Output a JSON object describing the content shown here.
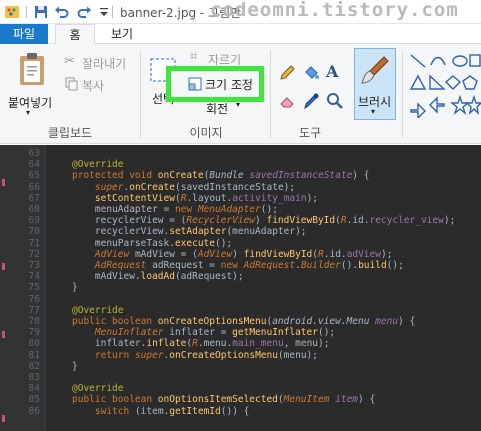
{
  "titlebar": {
    "title": "banner-2.jpg - 그림판",
    "watermark": "codeomni.tistory.com"
  },
  "tabs": [
    {
      "label": "파일"
    },
    {
      "label": "홈"
    },
    {
      "label": "보기"
    }
  ],
  "ribbon": {
    "clipboard": {
      "paste": "붙여넣기",
      "cut": "잘라내기",
      "copy": "복사",
      "group": "클립보드"
    },
    "image": {
      "select": "선택",
      "crop": "자르기",
      "resize": "크기 조정",
      "rotate": "회전",
      "group": "이미지"
    },
    "tools": {
      "group": "도구"
    },
    "brush": {
      "label": "브러시"
    }
  },
  "editor": {
    "lines": [
      {
        "n": "63",
        "html": ""
      },
      {
        "n": "64",
        "html": "<span class='ann'>@Override</span>"
      },
      {
        "n": "65",
        "html": "<span class='kw'>protected void </span><span class='call'>onCreate</span>(<span class='ital'>Bundle </span><span class='fld ital'>savedInstanceState</span>) {"
      },
      {
        "n": "66",
        "html": "    <span class='kw ital'>super</span>.<span class='call'>onCreate</span>(savedInstanceState);"
      },
      {
        "n": "67",
        "html": "    <span class='call'>setContentView</span>(<span class='typ'>R</span>.layout.<span class='fld'>activity_main</span>);"
      },
      {
        "n": "68",
        "html": "    menuAdapter = <span class='kw'>new </span><span class='typ'>MenuAdapter</span>();"
      },
      {
        "n": "69",
        "html": "    recyclerView = (<span class='typ'>RecyclerView</span>) <span class='call'>findViewById</span>(<span class='typ'>R</span>.id.<span class='fld'>recycler_view</span>);"
      },
      {
        "n": "70",
        "html": "    recyclerView.<span class='call'>setAdapter</span>(menuAdapter);"
      },
      {
        "n": "71",
        "html": "    menuParseTask.<span class='call'>execute</span>();"
      },
      {
        "n": "72",
        "html": "    <span class='typ'>AdView </span>mAdView = (<span class='typ'>AdView</span>) <span class='call'>findViewById</span>(<span class='typ'>R</span>.id.<span class='fld'>adView</span>);"
      },
      {
        "n": "73",
        "html": "    <span class='typ'>AdRequest </span>adRequest = <span class='kw'>new </span><span class='typ'>AdRequest</span>.<span class='typ'>Builder</span>().<span class='call'>build</span>();"
      },
      {
        "n": "74",
        "html": "    mAdView.<span class='call'>loadAd</span>(adRequest);"
      },
      {
        "n": "75",
        "html": "}"
      },
      {
        "n": "76",
        "html": ""
      },
      {
        "n": "77",
        "html": "<span class='ann'>@Override</span>"
      },
      {
        "n": "78",
        "html": "<span class='kw'>public boolean </span><span class='call'>onCreateOptionsMenu</span>(<span class='ital'>android.view.Menu </span><span class='fld ital'>menu</span>) {"
      },
      {
        "n": "79",
        "html": "    <span class='typ'>MenuInflater </span>inflater = <span class='call'>getMenuInflater</span>();"
      },
      {
        "n": "80",
        "html": "    inflater.<span class='call'>inflate</span>(<span class='typ'>R</span>.menu.<span class='fld'>main_menu</span>, menu);"
      },
      {
        "n": "81",
        "html": "    <span class='kw'>return </span><span class='kw ital'>super</span>.<span class='call'>onCreateOptionsMenu</span>(menu);"
      },
      {
        "n": "82",
        "html": "}"
      },
      {
        "n": "83",
        "html": ""
      },
      {
        "n": "84",
        "html": "<span class='ann'>@Override</span>"
      },
      {
        "n": "85",
        "html": "<span class='kw'>public boolean </span><span class='call'>onOptionsItemSelected</span>(<span class='typ'>MenuItem </span><span class='fld ital'>item</span>) {"
      },
      {
        "n": "86",
        "html": "    <span class='kw'>switch </span>(item.<span class='call'>getItemId</span>()) {"
      }
    ]
  }
}
